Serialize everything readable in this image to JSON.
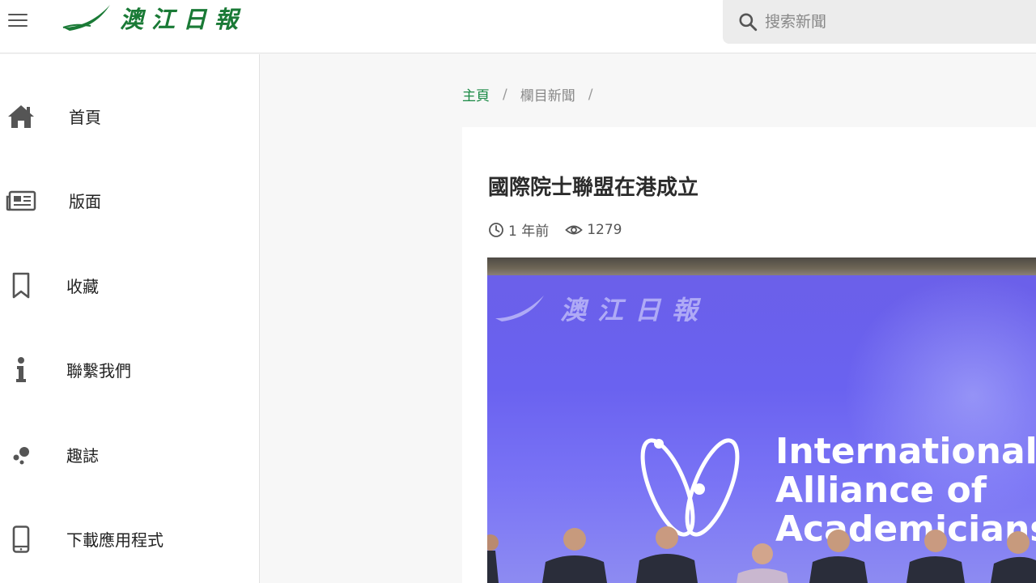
{
  "header": {
    "logo_text": "澳江日報",
    "search_placeholder": "搜索新聞"
  },
  "sidebar": {
    "items": [
      {
        "label": "首頁",
        "icon": "home-icon"
      },
      {
        "label": "版面",
        "icon": "newspaper-icon"
      },
      {
        "label": "收藏",
        "icon": "bookmark-icon"
      },
      {
        "label": "聯繫我們",
        "icon": "info-icon"
      },
      {
        "label": "趣誌",
        "icon": "bubbles-icon"
      },
      {
        "label": "下載應用程式",
        "icon": "mobile-icon"
      }
    ]
  },
  "breadcrumb": {
    "home": "主頁",
    "sep": "/",
    "section": "欄目新聞"
  },
  "article": {
    "title": "國際院士聯盟在港成立",
    "time": "1 年前",
    "views": "1279",
    "image": {
      "watermark": "澳江日報",
      "banner_text": "International\nAlliance of\nAcademicians"
    }
  },
  "colors": {
    "brand_green": "#1a7a36",
    "link_green": "#1a8a45",
    "banner_purple": "#6a62f0"
  }
}
